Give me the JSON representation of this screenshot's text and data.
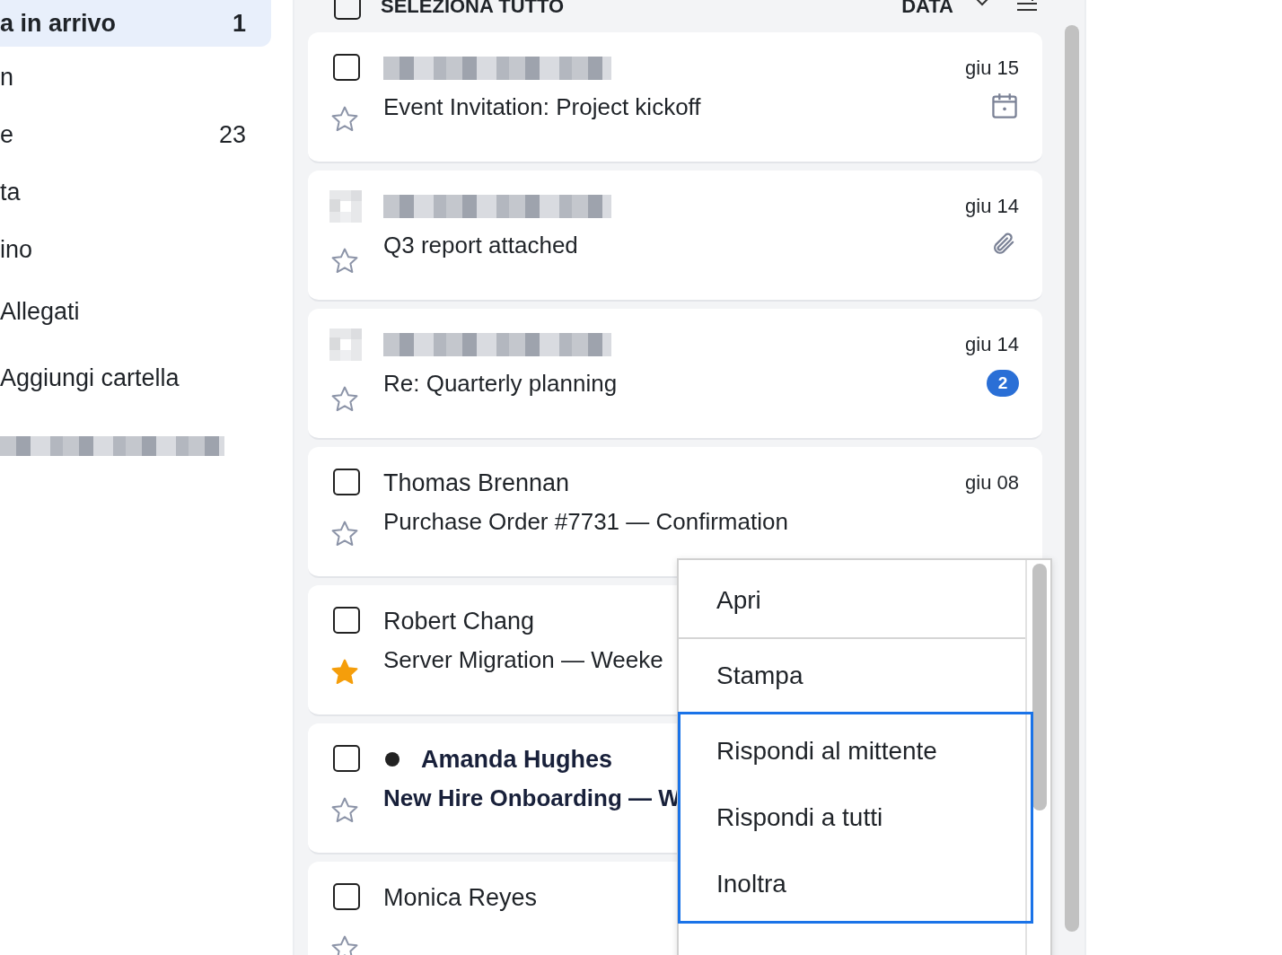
{
  "sidebar": {
    "items": [
      {
        "label": "a in arrivo",
        "count": "1",
        "selected": true
      },
      {
        "label": "n",
        "selected": false
      },
      {
        "label": "e",
        "count": "23",
        "selected": false
      },
      {
        "label": "ta",
        "selected": false
      },
      {
        "label": "ino",
        "selected": false
      },
      {
        "label": "Allegati",
        "selected": false
      },
      {
        "label": "Aggiungi cartella",
        "selected": false
      }
    ],
    "footer_redacted": true
  },
  "list_header": {
    "select_all": "SELEZIONA TUTTO",
    "select_all_checked": false,
    "sort": "DATA"
  },
  "messages": [
    {
      "avatar_redacted": false,
      "sender_redacted": true,
      "subject": "Event Invitation: Project kickoff",
      "date": "giu 15",
      "has_event": true,
      "starred": false,
      "unread": false,
      "checked": false
    },
    {
      "avatar_redacted": true,
      "sender_redacted": true,
      "subject": "Q3 report attached",
      "date": "giu 14",
      "has_attachment": true,
      "starred": false,
      "unread": false
    },
    {
      "avatar_redacted": true,
      "sender_redacted": true,
      "subject": "Re: Quarterly planning",
      "date": "giu 14",
      "thread_count": "2",
      "starred": false,
      "unread": false
    },
    {
      "sender": "Thomas Brennan",
      "subject": "Purchase Order #7731 — Confirmation",
      "date": "giu 08",
      "starred": false,
      "unread": false,
      "checked": false
    },
    {
      "sender": "Robert Chang",
      "subject": "Server Migration — Weeke",
      "starred": true,
      "unread": false,
      "checked": false
    },
    {
      "sender": "Amanda Hughes",
      "subject": "New Hire Onboarding — W",
      "starred": false,
      "unread": true,
      "checked": false
    },
    {
      "sender": "Monica Reyes",
      "starred": false,
      "unread": false,
      "checked": false
    }
  ],
  "context_menu": {
    "sections": [
      {
        "focused": false,
        "items": [
          "Apri"
        ]
      },
      {
        "focused": false,
        "items": [
          "Stampa"
        ]
      },
      {
        "focused": true,
        "items": [
          "Rispondi al mittente",
          "Rispondi a tutti",
          "Inoltra"
        ]
      }
    ]
  }
}
